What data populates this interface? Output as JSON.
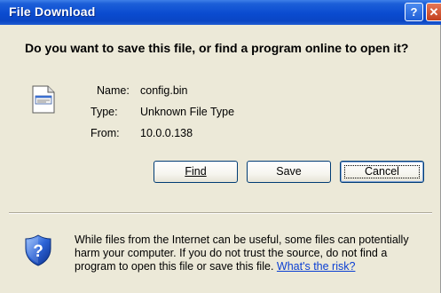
{
  "window": {
    "title": "File Download",
    "help_label": "?",
    "close_label": "✕"
  },
  "prompt": {
    "question": "Do you want to save this file, or find a program online to open it?"
  },
  "file": {
    "name_label": "Name:",
    "name": "config.bin",
    "type_label": "Type:",
    "type": "Unknown File Type",
    "from_label": "From:",
    "from": "10.0.0.138",
    "icon": "generic-file-icon"
  },
  "buttons": {
    "find_label": "Find",
    "save_label": "Save",
    "cancel_label": "Cancel"
  },
  "warning": {
    "text": "While files from the Internet can be useful, some files can potentially harm your computer. If you do not trust the source, do not find a program to open this file or save this file.",
    "link_text": "What's the risk?",
    "icon": "security-shield-icon"
  },
  "colors": {
    "titlebar": "#0a4bd0",
    "dialog_bg": "#ece9d8",
    "link": "#0b3fd3",
    "button_border": "#003c74"
  }
}
